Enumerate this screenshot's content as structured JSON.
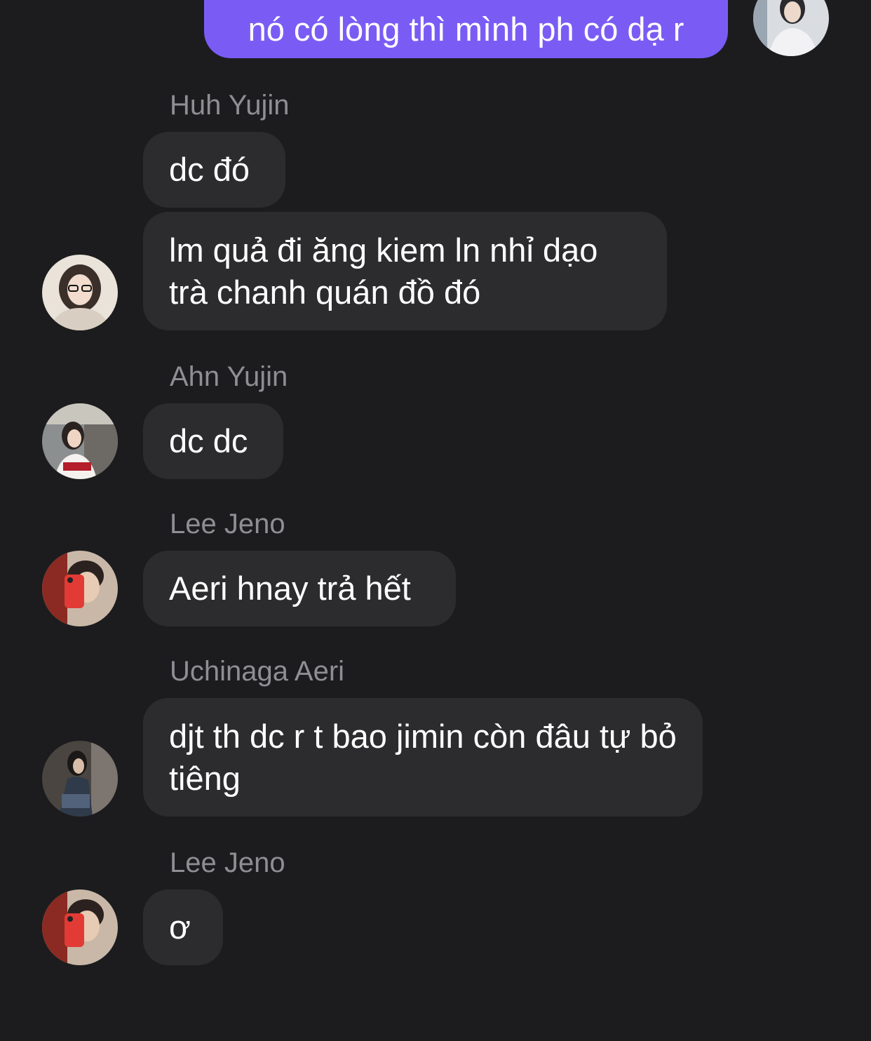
{
  "colors": {
    "background": "#1c1c1e",
    "incoming_bubble": "#2c2c2e",
    "outgoing_bubble": "#7a5cf5",
    "sender_name": "#8e8e93",
    "message_text": "#ffffff"
  },
  "messages": [
    {
      "id": "m0",
      "direction": "outgoing",
      "text": "nó có lòng thì mình ph có dạ r"
    },
    {
      "id": "m1",
      "direction": "incoming",
      "sender": "Huh Yujin",
      "text": "dc đó"
    },
    {
      "id": "m2",
      "direction": "incoming",
      "sender": "Huh Yujin",
      "text": "lm quả đi ăng kiem ln nhỉ dạo trà chanh quán đồ đó"
    },
    {
      "id": "m3",
      "direction": "incoming",
      "sender": "Ahn Yujin",
      "text": "dc dc"
    },
    {
      "id": "m4",
      "direction": "incoming",
      "sender": "Lee Jeno",
      "text": "Aeri hnay trả hết"
    },
    {
      "id": "m5",
      "direction": "incoming",
      "sender": "Uchinaga Aeri",
      "text": "djt th dc r t bao jimin còn đâu tự bỏ tiêng"
    },
    {
      "id": "m6",
      "direction": "incoming",
      "sender": "Lee Jeno",
      "text": "ơ"
    }
  ],
  "names": {
    "n1": "Huh Yujin",
    "n3": "Ahn Yujin",
    "n4": "Lee Jeno",
    "n5": "Uchinaga Aeri",
    "n6": "Lee Jeno"
  },
  "avatars": {
    "self": "self-avatar-photo",
    "huh_yujin": "huh-yujin-avatar-photo",
    "ahn_yujin": "ahn-yujin-avatar-photo",
    "lee_jeno": "lee-jeno-avatar-photo",
    "uchinaga_aeri": "uchinaga-aeri-avatar-photo"
  }
}
